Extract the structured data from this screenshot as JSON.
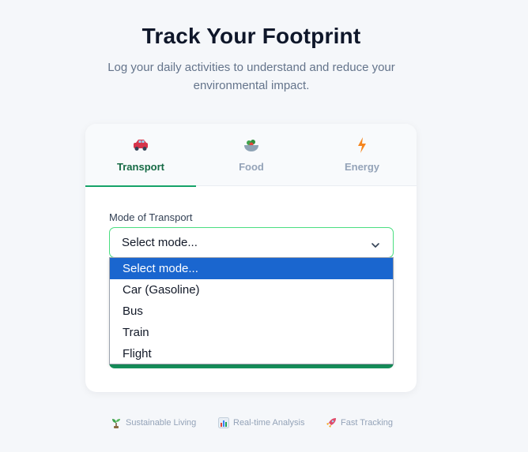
{
  "hero": {
    "title": "Track Your Footprint",
    "subtitle": "Log your daily activities to understand and reduce your environmental impact."
  },
  "tabs": [
    {
      "label": "Transport",
      "icon": "car-icon",
      "active": true
    },
    {
      "label": "Food",
      "icon": "salad-bowl-icon",
      "active": false
    },
    {
      "label": "Energy",
      "icon": "lightning-icon",
      "active": false
    }
  ],
  "form": {
    "field_label": "Mode of Transport",
    "select_value": "Select mode...",
    "options": [
      {
        "label": "Select mode...",
        "selected": true
      },
      {
        "label": "Car (Gasoline)",
        "selected": false
      },
      {
        "label": "Bus",
        "selected": false
      },
      {
        "label": "Train",
        "selected": false
      },
      {
        "label": "Flight",
        "selected": false
      }
    ]
  },
  "features": [
    {
      "label": "Sustainable Living",
      "icon": "seedling-icon"
    },
    {
      "label": "Real-time Analysis",
      "icon": "bar-chart-icon"
    },
    {
      "label": "Fast Tracking",
      "icon": "rocket-icon"
    }
  ],
  "colors": {
    "accent_green": "#16a369",
    "dropdown_highlight": "#1a66cf"
  }
}
